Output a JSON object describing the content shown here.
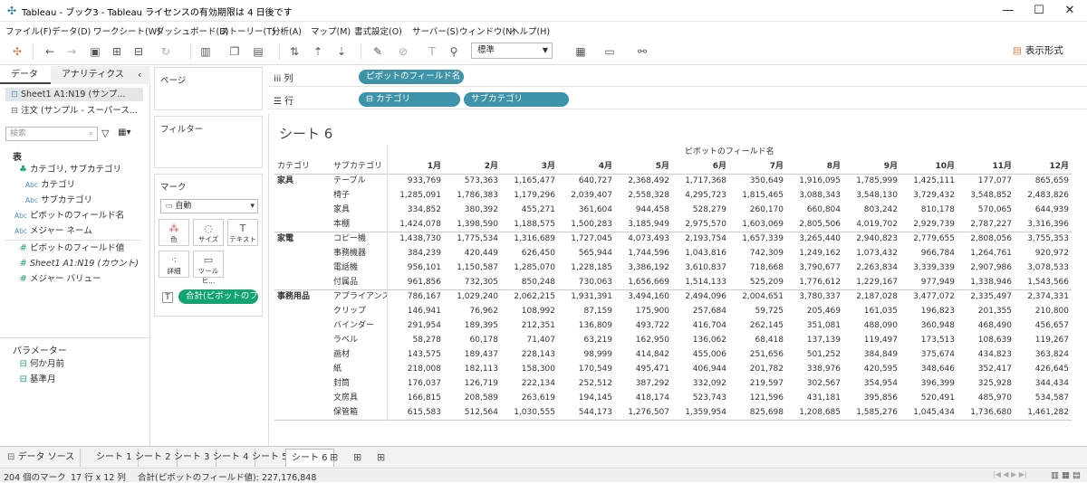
{
  "window": {
    "title": "Tableau - ブック3 - Tableau ライセンスの有効期限は 4 日後です",
    "min": "—",
    "max": "☐",
    "close": "✕"
  },
  "menu": [
    "ファイル(F)",
    "データ(D)",
    "ワークシート(W)",
    "ダッシュボード(B)",
    "ストーリー(T)",
    "分析(A)",
    "マップ(M)",
    "書式設定(O)",
    "サーバー(S)",
    "ウィンドウ(N)",
    "ヘルプ(H)"
  ],
  "toolbar": {
    "fit": "標準",
    "show_me": "表示形式"
  },
  "left": {
    "tab_data": "データ",
    "tab_analytics": "アナリティクス",
    "datasources": [
      "Sheet1 A1:N19 (サンプ...",
      "注文 (サンプル - スーパース..."
    ],
    "search_placeholder": "検索",
    "section_table": "表",
    "fields": [
      {
        "t": "♣",
        "label": "カテゴリ, サブカテゴリ"
      },
      {
        "t": "Abc",
        "label": "カテゴリ"
      },
      {
        "t": "Abc",
        "label": "サブカテゴリ"
      },
      {
        "t": "Abc",
        "label": "ピボットのフィールド名"
      },
      {
        "t": "Abc",
        "label": "メジャー ネーム"
      },
      {
        "t": "#",
        "label": "ピボットのフィールド値"
      },
      {
        "t": "#",
        "label": "Sheet1 A1:N19 (カウント)"
      },
      {
        "t": "#",
        "label": "メジャー バリュー"
      }
    ],
    "section_params": "パラメーター",
    "params": [
      "何か月前",
      "基準月"
    ]
  },
  "cards": {
    "pages": "ページ",
    "filters": "フィルター",
    "marks": "マーク",
    "mark_type": "自動",
    "mark_buttons": [
      "色",
      "サイズ",
      "テキスト",
      "詳細",
      "ツールヒ..."
    ],
    "mark_pill": "合計(ピボットのフ..."
  },
  "shelves": {
    "columns_label": "列",
    "rows_label": "行",
    "columns_pill": "ピボットのフィールド名",
    "rows_pills": [
      "⊟ カテゴリ",
      "サブカテゴリ"
    ]
  },
  "sheet": {
    "title": "シート 6",
    "top_header": "ピボットのフィールド名",
    "row_headers": [
      "カテゴリ",
      "サブカテゴリ"
    ],
    "months": [
      "1月",
      "2月",
      "3月",
      "4月",
      "5月",
      "6月",
      "7月",
      "8月",
      "9月",
      "10月",
      "11月",
      "12月"
    ],
    "groups": [
      {
        "cat": "家具",
        "rows": [
          {
            "sub": "テーブル",
            "v": [
              "933,769",
              "573,363",
              "1,165,477",
              "640,727",
              "2,368,492",
              "1,717,368",
              "350,649",
              "1,916,095",
              "1,785,999",
              "1,425,111",
              "177,077",
              "865,659"
            ]
          },
          {
            "sub": "椅子",
            "v": [
              "1,285,091",
              "1,786,383",
              "1,179,296",
              "2,039,407",
              "2,558,328",
              "4,295,723",
              "1,815,465",
              "3,088,343",
              "3,548,130",
              "3,729,432",
              "3,548,852",
              "2,483,826"
            ]
          },
          {
            "sub": "家具",
            "v": [
              "334,852",
              "380,392",
              "455,271",
              "361,604",
              "944,458",
              "528,279",
              "260,170",
              "660,804",
              "803,242",
              "810,178",
              "570,065",
              "644,939"
            ]
          },
          {
            "sub": "本棚",
            "v": [
              "1,424,078",
              "1,398,590",
              "1,188,575",
              "1,500,283",
              "3,185,949",
              "2,975,570",
              "1,603,069",
              "2,805,506",
              "4,019,702",
              "2,929,739",
              "2,787,227",
              "3,316,396"
            ]
          }
        ]
      },
      {
        "cat": "家電",
        "rows": [
          {
            "sub": "コピー機",
            "v": [
              "1,438,730",
              "1,775,534",
              "1,316,689",
              "1,727,045",
              "4,073,493",
              "2,193,754",
              "1,657,339",
              "3,265,440",
              "2,940,823",
              "2,779,655",
              "2,808,056",
              "3,755,353"
            ]
          },
          {
            "sub": "事務機器",
            "v": [
              "384,239",
              "420,449",
              "626,450",
              "565,944",
              "1,744,596",
              "1,043,816",
              "742,309",
              "1,249,162",
              "1,073,432",
              "966,784",
              "1,264,761",
              "920,972"
            ]
          },
          {
            "sub": "電話機",
            "v": [
              "956,101",
              "1,150,587",
              "1,285,070",
              "1,228,185",
              "3,386,192",
              "3,610,837",
              "718,668",
              "3,790,677",
              "2,263,834",
              "3,339,339",
              "2,907,986",
              "3,078,533"
            ]
          },
          {
            "sub": "付属品",
            "v": [
              "961,856",
              "732,305",
              "850,248",
              "730,063",
              "1,656,669",
              "1,514,133",
              "525,209",
              "1,776,612",
              "1,229,167",
              "977,949",
              "1,338,946",
              "1,543,566"
            ]
          }
        ]
      },
      {
        "cat": "事務用品",
        "rows": [
          {
            "sub": "アプライアンス",
            "v": [
              "786,167",
              "1,029,240",
              "2,062,215",
              "1,931,391",
              "3,494,160",
              "2,494,096",
              "2,004,651",
              "3,780,337",
              "2,187,028",
              "3,477,072",
              "2,335,497",
              "2,374,331"
            ]
          },
          {
            "sub": "クリップ",
            "v": [
              "146,941",
              "76,962",
              "108,992",
              "87,159",
              "175,900",
              "257,684",
              "59,725",
              "205,469",
              "161,035",
              "196,823",
              "201,355",
              "210,800"
            ]
          },
          {
            "sub": "バインダー",
            "v": [
              "291,954",
              "189,395",
              "212,351",
              "136,809",
              "493,722",
              "416,704",
              "262,145",
              "351,081",
              "488,090",
              "360,948",
              "468,490",
              "456,657"
            ]
          },
          {
            "sub": "ラベル",
            "v": [
              "58,278",
              "60,178",
              "71,407",
              "63,219",
              "162,950",
              "136,062",
              "68,418",
              "137,139",
              "119,497",
              "173,513",
              "108,639",
              "119,267"
            ]
          },
          {
            "sub": "画材",
            "v": [
              "143,575",
              "189,437",
              "228,143",
              "98,999",
              "414,842",
              "455,006",
              "251,656",
              "501,252",
              "384,849",
              "375,674",
              "434,823",
              "363,824"
            ]
          },
          {
            "sub": "紙",
            "v": [
              "218,008",
              "182,113",
              "158,300",
              "170,549",
              "495,471",
              "406,944",
              "201,782",
              "338,976",
              "420,595",
              "348,646",
              "352,417",
              "426,645"
            ]
          },
          {
            "sub": "封筒",
            "v": [
              "176,037",
              "126,719",
              "222,134",
              "252,512",
              "387,292",
              "332,092",
              "219,597",
              "302,567",
              "354,954",
              "396,399",
              "325,928",
              "344,434"
            ]
          },
          {
            "sub": "文房具",
            "v": [
              "166,815",
              "208,589",
              "263,619",
              "194,145",
              "418,174",
              "523,743",
              "121,596",
              "431,181",
              "395,856",
              "520,491",
              "485,970",
              "534,587"
            ]
          },
          {
            "sub": "保管箱",
            "v": [
              "615,583",
              "512,564",
              "1,030,555",
              "544,173",
              "1,276,507",
              "1,359,954",
              "825,698",
              "1,208,685",
              "1,585,276",
              "1,045,434",
              "1,736,680",
              "1,461,282"
            ]
          }
        ]
      }
    ]
  },
  "tabs": {
    "datasource": "データ ソース",
    "sheets": [
      "シート 1",
      "シート 2",
      "シート 3",
      "シート 4",
      "シート 5",
      "シート 6"
    ],
    "active": 5
  },
  "status": {
    "marks": "204 個のマーク",
    "dims": "17 行 x 12 列",
    "sum": "合計(ピボットのフィールド値): 227,176,848"
  }
}
